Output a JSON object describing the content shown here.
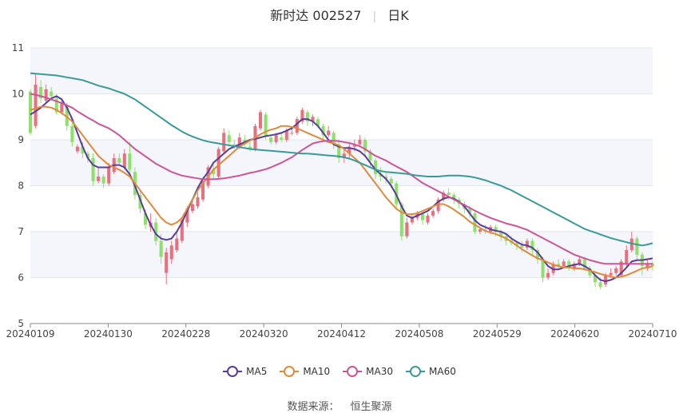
{
  "header": {
    "stock": "新时达 002527",
    "period": "日K"
  },
  "footer": {
    "source_label": "数据来源：",
    "source_value": "恒生聚源"
  },
  "chart_data": {
    "type": "candlestick",
    "y_ticks": [
      5,
      6,
      7,
      8,
      9,
      10,
      11
    ],
    "ylim": [
      5,
      11
    ],
    "x_ticks": [
      "20240109",
      "20240130",
      "20240228",
      "20240320",
      "20240412",
      "20240508",
      "20240529",
      "20240620",
      "20240710"
    ],
    "n_candles": 120,
    "up_color": "#e8707e",
    "down_color": "#8ee06a",
    "candles": [
      [
        10.05,
        9.15,
        10.1,
        9.1
      ],
      [
        9.3,
        10.2,
        10.45,
        9.25
      ],
      [
        10.15,
        9.9,
        10.3,
        9.8
      ],
      [
        9.85,
        10.1,
        10.2,
        9.8
      ],
      [
        10.05,
        9.95,
        10.15,
        9.85
      ],
      [
        9.9,
        9.6,
        10.0,
        9.55
      ],
      [
        9.6,
        9.8,
        9.9,
        9.55
      ],
      [
        9.75,
        9.3,
        9.8,
        9.2
      ],
      [
        9.3,
        8.95,
        9.4,
        8.85
      ],
      [
        8.75,
        8.85,
        8.9,
        8.7
      ],
      [
        8.85,
        8.7,
        8.95,
        8.6
      ],
      [
        8.7,
        8.6,
        8.75,
        8.5
      ],
      [
        8.6,
        8.1,
        8.7,
        8.0
      ],
      [
        8.1,
        8.2,
        8.4,
        8.05
      ],
      [
        8.2,
        8.05,
        8.25,
        7.95
      ],
      [
        8.05,
        8.4,
        8.5,
        8.0
      ],
      [
        8.3,
        8.6,
        8.7,
        8.25
      ],
      [
        8.6,
        8.5,
        8.7,
        8.45
      ],
      [
        8.4,
        8.7,
        8.8,
        8.35
      ],
      [
        8.7,
        8.35,
        8.95,
        8.25
      ],
      [
        8.3,
        7.8,
        8.4,
        7.7
      ],
      [
        7.8,
        7.5,
        7.9,
        7.4
      ],
      [
        7.4,
        7.15,
        7.5,
        7.05
      ],
      [
        7.1,
        7.2,
        7.4,
        7.0
      ],
      [
        7.2,
        6.8,
        7.3,
        6.7
      ],
      [
        6.8,
        6.45,
        6.95,
        6.3
      ],
      [
        6.1,
        6.55,
        6.65,
        5.85
      ],
      [
        6.4,
        6.7,
        6.8,
        6.3
      ],
      [
        6.6,
        6.85,
        7.0,
        6.55
      ],
      [
        6.8,
        7.25,
        7.3,
        6.75
      ],
      [
        7.2,
        7.5,
        7.55,
        7.1
      ],
      [
        7.45,
        7.6,
        7.7,
        7.4
      ],
      [
        7.55,
        7.75,
        7.85,
        7.5
      ],
      [
        7.7,
        8.1,
        8.15,
        7.65
      ],
      [
        8.0,
        8.4,
        8.45,
        7.95
      ],
      [
        8.35,
        8.25,
        8.5,
        8.15
      ],
      [
        8.2,
        8.8,
        8.85,
        8.15
      ],
      [
        8.75,
        9.15,
        9.25,
        8.7
      ],
      [
        9.1,
        8.95,
        9.2,
        8.85
      ],
      [
        8.9,
        8.85,
        9.0,
        8.8
      ],
      [
        8.85,
        9.05,
        9.15,
        8.8
      ],
      [
        9.0,
        8.9,
        9.1,
        8.85
      ],
      [
        8.85,
        8.8,
        8.95,
        8.75
      ],
      [
        8.8,
        9.3,
        9.35,
        8.75
      ],
      [
        9.25,
        9.6,
        9.65,
        9.2
      ],
      [
        9.55,
        9.1,
        9.6,
        9.0
      ],
      [
        9.05,
        8.95,
        9.1,
        8.9
      ],
      [
        8.95,
        9.1,
        9.15,
        8.9
      ],
      [
        9.05,
        9.0,
        9.15,
        8.95
      ],
      [
        9.0,
        9.2,
        9.25,
        8.95
      ],
      [
        9.15,
        9.15,
        9.3,
        9.1
      ],
      [
        9.15,
        9.45,
        9.5,
        9.1
      ],
      [
        9.4,
        9.65,
        9.7,
        9.35
      ],
      [
        9.6,
        9.4,
        9.65,
        9.3
      ],
      [
        9.4,
        9.5,
        9.55,
        9.3
      ],
      [
        9.45,
        9.3,
        9.5,
        9.25
      ],
      [
        9.3,
        9.1,
        9.35,
        9.0
      ],
      [
        9.1,
        9.2,
        9.3,
        9.05
      ],
      [
        9.15,
        8.9,
        9.2,
        8.8
      ],
      [
        8.9,
        8.6,
        9.0,
        8.5
      ],
      [
        8.6,
        8.7,
        8.8,
        8.5
      ],
      [
        8.7,
        8.85,
        8.95,
        8.6
      ],
      [
        8.85,
        8.9,
        9.0,
        8.75
      ],
      [
        8.9,
        9.0,
        9.1,
        8.85
      ],
      [
        9.0,
        8.75,
        9.05,
        8.65
      ],
      [
        8.75,
        8.55,
        8.8,
        8.4
      ],
      [
        8.55,
        8.25,
        8.6,
        8.15
      ],
      [
        8.25,
        8.2,
        8.4,
        8.1
      ],
      [
        8.2,
        8.15,
        8.3,
        8.05
      ],
      [
        8.15,
        8.05,
        8.2,
        7.95
      ],
      [
        8.05,
        7.6,
        8.1,
        7.5
      ],
      [
        7.6,
        6.9,
        7.65,
        6.8
      ],
      [
        6.9,
        7.2,
        7.3,
        6.85
      ],
      [
        7.2,
        7.3,
        7.4,
        7.15
      ],
      [
        7.3,
        7.4,
        7.45,
        7.25
      ],
      [
        7.4,
        7.25,
        7.45,
        7.15
      ],
      [
        7.2,
        7.35,
        7.4,
        7.15
      ],
      [
        7.35,
        7.45,
        7.5,
        7.3
      ],
      [
        7.45,
        7.7,
        7.75,
        7.4
      ],
      [
        7.7,
        7.85,
        7.9,
        7.65
      ],
      [
        7.85,
        7.8,
        7.95,
        7.7
      ],
      [
        7.8,
        7.7,
        7.85,
        7.6
      ],
      [
        7.7,
        7.6,
        7.75,
        7.5
      ],
      [
        7.6,
        7.5,
        7.65,
        7.4
      ],
      [
        7.5,
        7.4,
        7.55,
        7.3
      ],
      [
        7.4,
        7.0,
        7.45,
        6.95
      ],
      [
        7.0,
        7.05,
        7.1,
        6.95
      ],
      [
        7.05,
        7.0,
        7.15,
        6.95
      ],
      [
        7.0,
        7.1,
        7.15,
        6.95
      ],
      [
        7.1,
        7.0,
        7.15,
        6.9
      ],
      [
        7.0,
        6.9,
        7.05,
        6.8
      ],
      [
        6.9,
        6.8,
        6.95,
        6.7
      ],
      [
        6.8,
        6.75,
        6.9,
        6.7
      ],
      [
        6.75,
        6.7,
        6.8,
        6.6
      ],
      [
        6.7,
        6.65,
        6.8,
        6.55
      ],
      [
        6.65,
        6.8,
        6.85,
        6.6
      ],
      [
        6.8,
        6.6,
        6.85,
        6.5
      ],
      [
        6.6,
        6.4,
        6.65,
        6.3
      ],
      [
        6.4,
        6.0,
        6.45,
        5.9
      ],
      [
        6.0,
        6.1,
        6.2,
        5.95
      ],
      [
        6.1,
        6.3,
        6.35,
        6.05
      ],
      [
        6.3,
        6.25,
        6.4,
        6.2
      ],
      [
        6.25,
        6.35,
        6.4,
        6.2
      ],
      [
        6.35,
        6.2,
        6.4,
        6.15
      ],
      [
        6.2,
        6.3,
        6.35,
        6.15
      ],
      [
        6.3,
        6.4,
        6.45,
        6.25
      ],
      [
        6.4,
        6.2,
        6.45,
        6.15
      ],
      [
        6.2,
        6.05,
        6.25,
        6.0
      ],
      [
        6.05,
        5.9,
        6.1,
        5.8
      ],
      [
        5.9,
        5.8,
        6.0,
        5.75
      ],
      [
        5.85,
        6.05,
        6.1,
        5.8
      ],
      [
        6.05,
        6.1,
        6.2,
        6.0
      ],
      [
        6.1,
        6.2,
        6.25,
        6.05
      ],
      [
        6.05,
        6.35,
        6.4,
        6.0
      ],
      [
        6.3,
        6.6,
        6.7,
        6.25
      ],
      [
        6.6,
        6.85,
        7.0,
        6.55
      ],
      [
        6.85,
        6.5,
        6.9,
        6.4
      ],
      [
        6.5,
        6.25,
        6.55,
        6.05
      ],
      [
        6.2,
        6.3,
        6.4,
        6.15
      ],
      [
        6.3,
        6.25,
        6.35,
        6.15
      ]
    ],
    "series": [
      {
        "name": "MA5",
        "color": "#5b3c9a",
        "values": [
          9.55,
          9.62,
          9.7,
          9.8,
          9.9,
          9.95,
          9.88,
          9.7,
          9.45,
          9.15,
          8.85,
          8.6,
          8.45,
          8.4,
          8.4,
          8.4,
          8.45,
          8.45,
          8.4,
          8.25,
          8.0,
          7.7,
          7.4,
          7.15,
          6.95,
          6.85,
          6.82,
          6.85,
          7.0,
          7.2,
          7.45,
          7.7,
          7.95,
          8.15,
          8.3,
          8.5,
          8.6,
          8.7,
          8.8,
          8.85,
          8.9,
          8.95,
          9.0,
          9.02,
          9.05,
          9.08,
          9.1,
          9.12,
          9.15,
          9.2,
          9.25,
          9.35,
          9.45,
          9.45,
          9.4,
          9.3,
          9.15,
          9.0,
          8.9,
          8.85,
          8.82,
          8.82,
          8.8,
          8.75,
          8.65,
          8.5,
          8.35,
          8.25,
          8.15,
          8.0,
          7.8,
          7.55,
          7.35,
          7.3,
          7.35,
          7.4,
          7.45,
          7.55,
          7.65,
          7.72,
          7.75,
          7.72,
          7.65,
          7.55,
          7.4,
          7.25,
          7.15,
          7.1,
          7.05,
          7.02,
          7.0,
          6.95,
          6.85,
          6.78,
          6.72,
          6.7,
          6.65,
          6.55,
          6.4,
          6.25,
          6.18,
          6.18,
          6.22,
          6.25,
          6.28,
          6.3,
          6.25,
          6.18,
          6.05,
          5.95,
          5.92,
          5.95,
          6.0,
          6.1,
          6.22,
          6.35,
          6.38,
          6.38,
          6.4,
          6.42
        ]
      },
      {
        "name": "MA10",
        "color": "#e08a3c",
        "values": [
          9.65,
          9.68,
          9.72,
          9.72,
          9.7,
          9.65,
          9.58,
          9.5,
          9.4,
          9.25,
          9.1,
          8.95,
          8.8,
          8.65,
          8.55,
          8.45,
          8.4,
          8.35,
          8.28,
          8.2,
          8.05,
          7.9,
          7.75,
          7.6,
          7.45,
          7.3,
          7.2,
          7.15,
          7.2,
          7.3,
          7.5,
          7.7,
          7.9,
          8.05,
          8.2,
          8.35,
          8.45,
          8.55,
          8.65,
          8.75,
          8.85,
          8.92,
          8.98,
          9.05,
          9.12,
          9.18,
          9.22,
          9.25,
          9.3,
          9.3,
          9.28,
          9.25,
          9.2,
          9.15,
          9.1,
          9.05,
          9.0,
          8.95,
          8.92,
          8.88,
          8.8,
          8.7,
          8.6,
          8.5,
          8.35,
          8.2,
          8.05,
          7.9,
          7.75,
          7.62,
          7.5,
          7.42,
          7.38,
          7.38,
          7.4,
          7.45,
          7.5,
          7.55,
          7.6,
          7.6,
          7.55,
          7.48,
          7.4,
          7.32,
          7.22,
          7.15,
          7.08,
          7.02,
          6.98,
          6.95,
          6.9,
          6.85,
          6.78,
          6.7,
          6.62,
          6.55,
          6.48,
          6.42,
          6.38,
          6.33,
          6.28,
          6.25,
          6.22,
          6.22,
          6.2,
          6.2,
          6.18,
          6.15,
          6.12,
          6.08,
          6.05,
          6.02,
          6.0,
          6.02,
          6.05,
          6.1,
          6.15,
          6.2,
          6.22,
          6.25
        ]
      },
      {
        "name": "MA30",
        "color": "#cc5599",
        "values": [
          10.0,
          9.98,
          9.95,
          9.92,
          9.88,
          9.84,
          9.8,
          9.75,
          9.7,
          9.62,
          9.55,
          9.48,
          9.42,
          9.35,
          9.3,
          9.25,
          9.18,
          9.1,
          9.0,
          8.9,
          8.8,
          8.72,
          8.64,
          8.56,
          8.48,
          8.42,
          8.36,
          8.3,
          8.26,
          8.22,
          8.2,
          8.18,
          8.16,
          8.14,
          8.14,
          8.14,
          8.15,
          8.16,
          8.18,
          8.2,
          8.22,
          8.25,
          8.28,
          8.3,
          8.33,
          8.36,
          8.4,
          8.45,
          8.5,
          8.56,
          8.62,
          8.7,
          8.78,
          8.85,
          8.92,
          8.95,
          8.97,
          8.98,
          8.98,
          8.97,
          8.95,
          8.93,
          8.9,
          8.86,
          8.8,
          8.72,
          8.65,
          8.6,
          8.55,
          8.48,
          8.42,
          8.36,
          8.3,
          8.22,
          8.14,
          8.06,
          8.0,
          7.94,
          7.88,
          7.82,
          7.76,
          7.7,
          7.64,
          7.58,
          7.52,
          7.46,
          7.4,
          7.35,
          7.3,
          7.26,
          7.22,
          7.18,
          7.15,
          7.12,
          7.08,
          7.04,
          6.98,
          6.92,
          6.86,
          6.8,
          6.74,
          6.68,
          6.62,
          6.56,
          6.5,
          6.46,
          6.42,
          6.38,
          6.35,
          6.32,
          6.3,
          6.3,
          6.3,
          6.3,
          6.3,
          6.3,
          6.3,
          6.3,
          6.3,
          6.3
        ]
      },
      {
        "name": "MA60",
        "color": "#3a9a9a",
        "values": [
          10.45,
          10.44,
          10.43,
          10.42,
          10.41,
          10.4,
          10.38,
          10.36,
          10.34,
          10.32,
          10.3,
          10.26,
          10.22,
          10.18,
          10.15,
          10.12,
          10.08,
          10.04,
          10.0,
          9.94,
          9.88,
          9.8,
          9.72,
          9.64,
          9.56,
          9.48,
          9.4,
          9.32,
          9.25,
          9.18,
          9.12,
          9.07,
          9.03,
          8.99,
          8.96,
          8.94,
          8.92,
          8.9,
          8.88,
          8.86,
          8.84,
          8.82,
          8.8,
          8.79,
          8.78,
          8.77,
          8.76,
          8.75,
          8.74,
          8.73,
          8.72,
          8.71,
          8.7,
          8.7,
          8.69,
          8.68,
          8.67,
          8.66,
          8.65,
          8.64,
          8.62,
          8.59,
          8.55,
          8.5,
          8.45,
          8.4,
          8.35,
          8.32,
          8.3,
          8.29,
          8.28,
          8.27,
          8.26,
          8.24,
          8.22,
          8.21,
          8.2,
          8.2,
          8.2,
          8.21,
          8.22,
          8.22,
          8.22,
          8.21,
          8.2,
          8.18,
          8.15,
          8.12,
          8.08,
          8.04,
          8.0,
          7.95,
          7.9,
          7.84,
          7.78,
          7.72,
          7.66,
          7.6,
          7.54,
          7.48,
          7.42,
          7.36,
          7.3,
          7.24,
          7.18,
          7.12,
          7.06,
          7.02,
          6.98,
          6.94,
          6.9,
          6.86,
          6.83,
          6.8,
          6.77,
          6.74,
          6.72,
          6.7,
          6.72,
          6.75
        ]
      }
    ]
  }
}
